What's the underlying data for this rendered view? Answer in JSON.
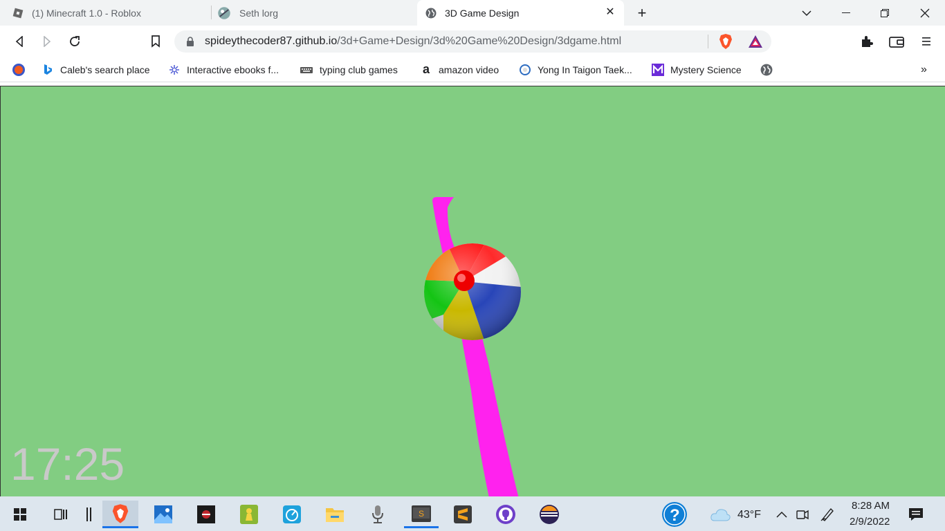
{
  "tabs": [
    {
      "title": "(1) Minecraft 1.0 - Roblox",
      "icon": "roblox-icon"
    },
    {
      "title": "Seth lorg",
      "icon": "sticker-icon"
    },
    {
      "title": "3D Game Design",
      "icon": "globe-icon",
      "active": true
    }
  ],
  "address": {
    "host": "spideythecoder87.github.io",
    "path": "/3d+Game+Design/3d%20Game%20Design/3dgame.html"
  },
  "bookmarks": [
    {
      "label": "",
      "icon": "brave-rewards-icon"
    },
    {
      "label": "Caleb's search place",
      "icon": "bing-icon"
    },
    {
      "label": "Interactive ebooks f...",
      "icon": "sparkle-icon"
    },
    {
      "label": "typing club games",
      "icon": "keyboard-icon"
    },
    {
      "label": "amazon video",
      "icon": "amazon-icon"
    },
    {
      "label": "Yong In Taigon Taek...",
      "icon": "taekwondo-icon"
    },
    {
      "label": "Mystery Science",
      "icon": "mystery-science-icon"
    },
    {
      "label": "",
      "icon": "globe-icon"
    }
  ],
  "bookmarks_more": "»",
  "game": {
    "timer": "17:25",
    "background_color": "#82cd82",
    "path_color": "#ff22ee"
  },
  "taskbar": {
    "weather": "43°F",
    "time": "8:28 AM",
    "date": "2/9/2022"
  }
}
